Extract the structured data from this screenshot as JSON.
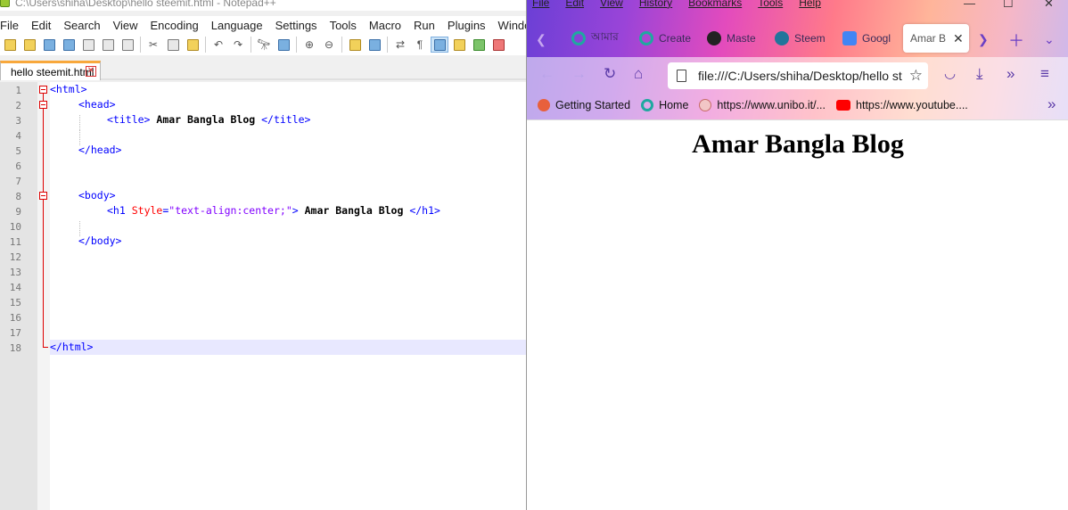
{
  "notepad": {
    "title": "C:\\Users\\shiha\\Desktop\\hello steemit.html - Notepad++",
    "menu": [
      "File",
      "Edit",
      "Search",
      "View",
      "Encoding",
      "Language",
      "Settings",
      "Tools",
      "Macro",
      "Run",
      "Plugins",
      "Window",
      "?"
    ],
    "tab_label": "hello steemit.html",
    "line_numbers": [
      "1",
      "2",
      "3",
      "4",
      "5",
      "6",
      "7",
      "8",
      "9",
      "10",
      "11",
      "12",
      "13",
      "14",
      "15",
      "16",
      "17",
      "18"
    ],
    "code": {
      "l1": "<html>",
      "l2": "<head>",
      "l3_open": "<title>",
      "l3_text": " Amar Bangla Blog ",
      "l3_close": "</title>",
      "l5": "</head>",
      "l8": "<body>",
      "l9_tag": "<h1",
      "l9_attr": "Style",
      "l9_eq": "=",
      "l9_str": "\"text-align:center;\"",
      "l9_gt": ">",
      "l9_text": " Amar Bangla Blog ",
      "l9_close": "</h1>",
      "l11": "</body>",
      "l18": "</html>"
    }
  },
  "firefox": {
    "menu": [
      "File",
      "Edit",
      "View",
      "History",
      "Bookmarks",
      "Tools",
      "Help"
    ],
    "tabs": [
      {
        "label": "আমার",
        "color": "#1fa8a0"
      },
      {
        "label": "Create",
        "color": "#1fa8a0"
      },
      {
        "label": "Maste",
        "color": "#222222"
      },
      {
        "label": "Steem",
        "color": "#21759b"
      },
      {
        "label": "Googl",
        "color": "#4285f4"
      },
      {
        "label": "Amar B",
        "color": "#ffffff"
      }
    ],
    "url": "file:///C:/Users/shiha/Desktop/hello st",
    "bookmarks": [
      {
        "label": "Getting Started",
        "color": "#e8603c"
      },
      {
        "label": "Home",
        "color": "#1fa8a0"
      },
      {
        "label": "https://www.unibo.it/...",
        "color": "#c76a6a"
      },
      {
        "label": "https://www.youtube....",
        "color": "#ff0000"
      }
    ],
    "page_heading": "Amar Bangla Blog"
  }
}
